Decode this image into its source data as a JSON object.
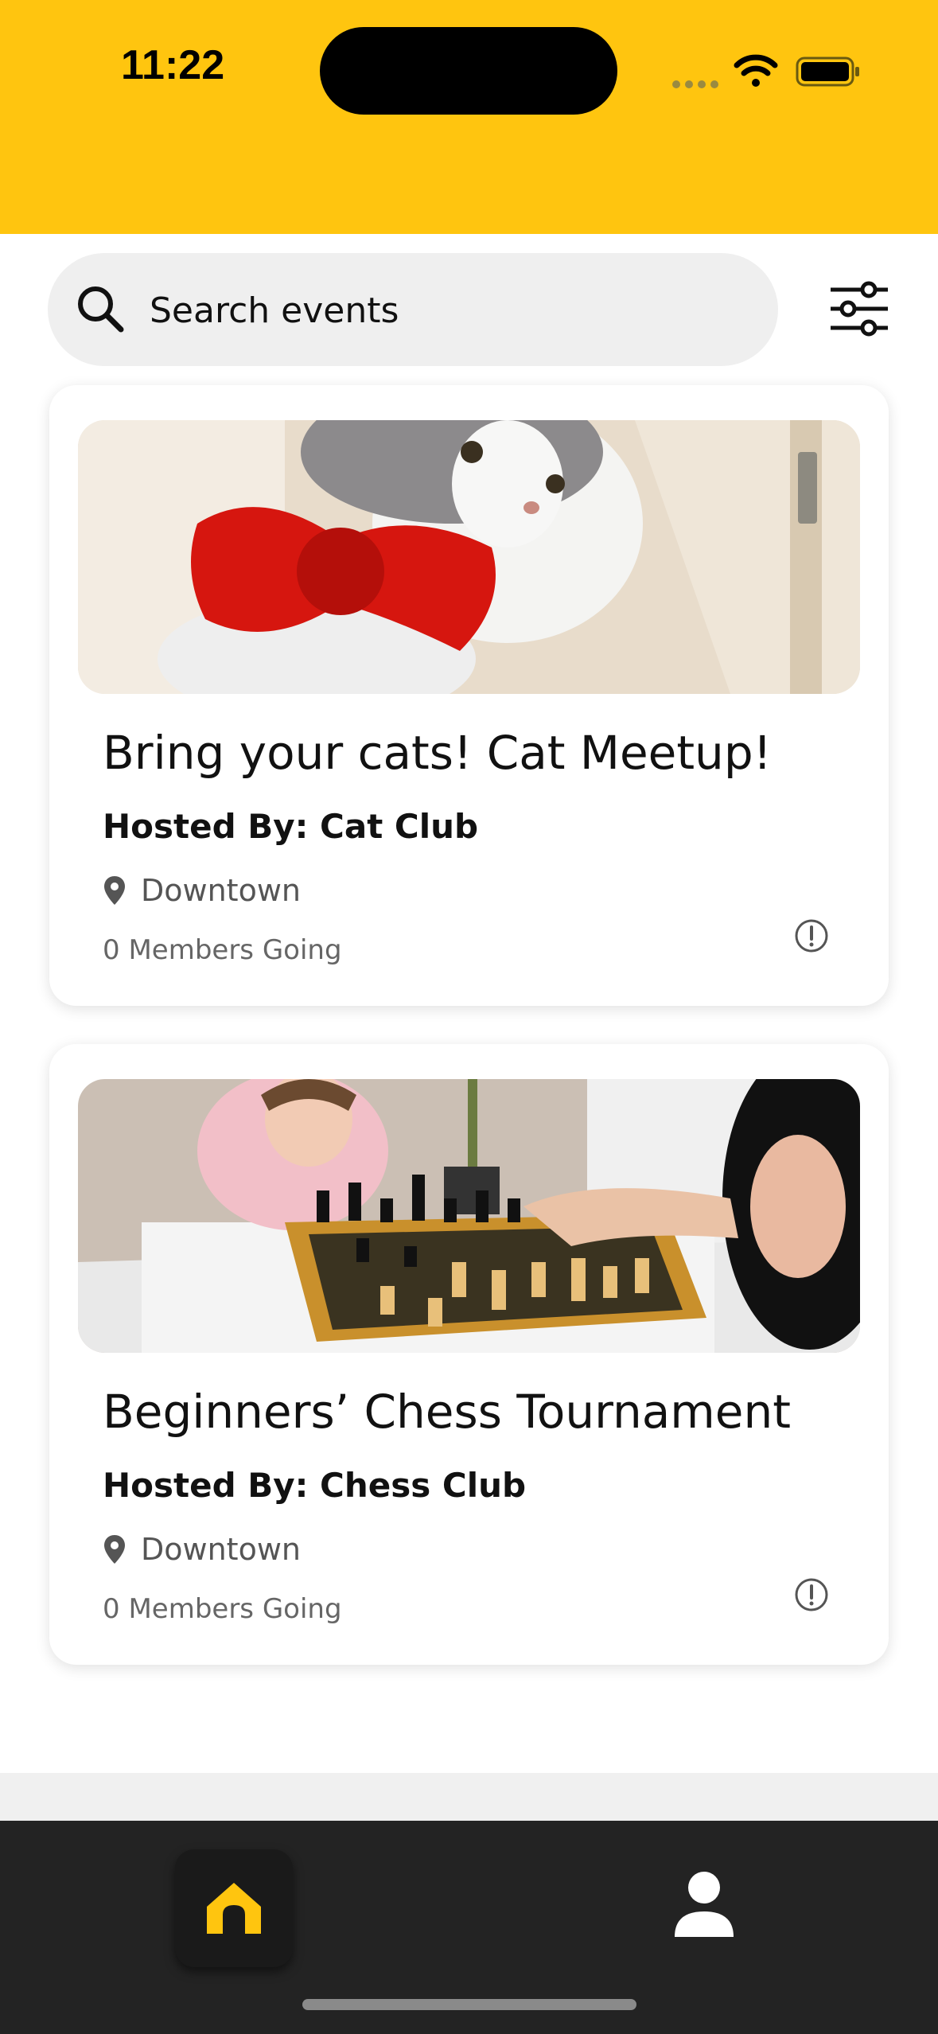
{
  "status_bar": {
    "time": "11:22"
  },
  "search": {
    "placeholder": "Search events"
  },
  "events": [
    {
      "title": "Bring your cats! Cat Meetup!",
      "host": "Hosted By: Cat Club",
      "location": "Downtown",
      "members": "0 Members Going"
    },
    {
      "title": "Beginners’ Chess Tournament",
      "host": "Hosted By: Chess Club",
      "location": "Downtown",
      "members": "0 Members Going"
    }
  ],
  "nav": {
    "items": [
      "home-icon",
      "profile-icon"
    ]
  },
  "colors": {
    "accent": "#FFC50F",
    "nav_bg": "#232323"
  }
}
